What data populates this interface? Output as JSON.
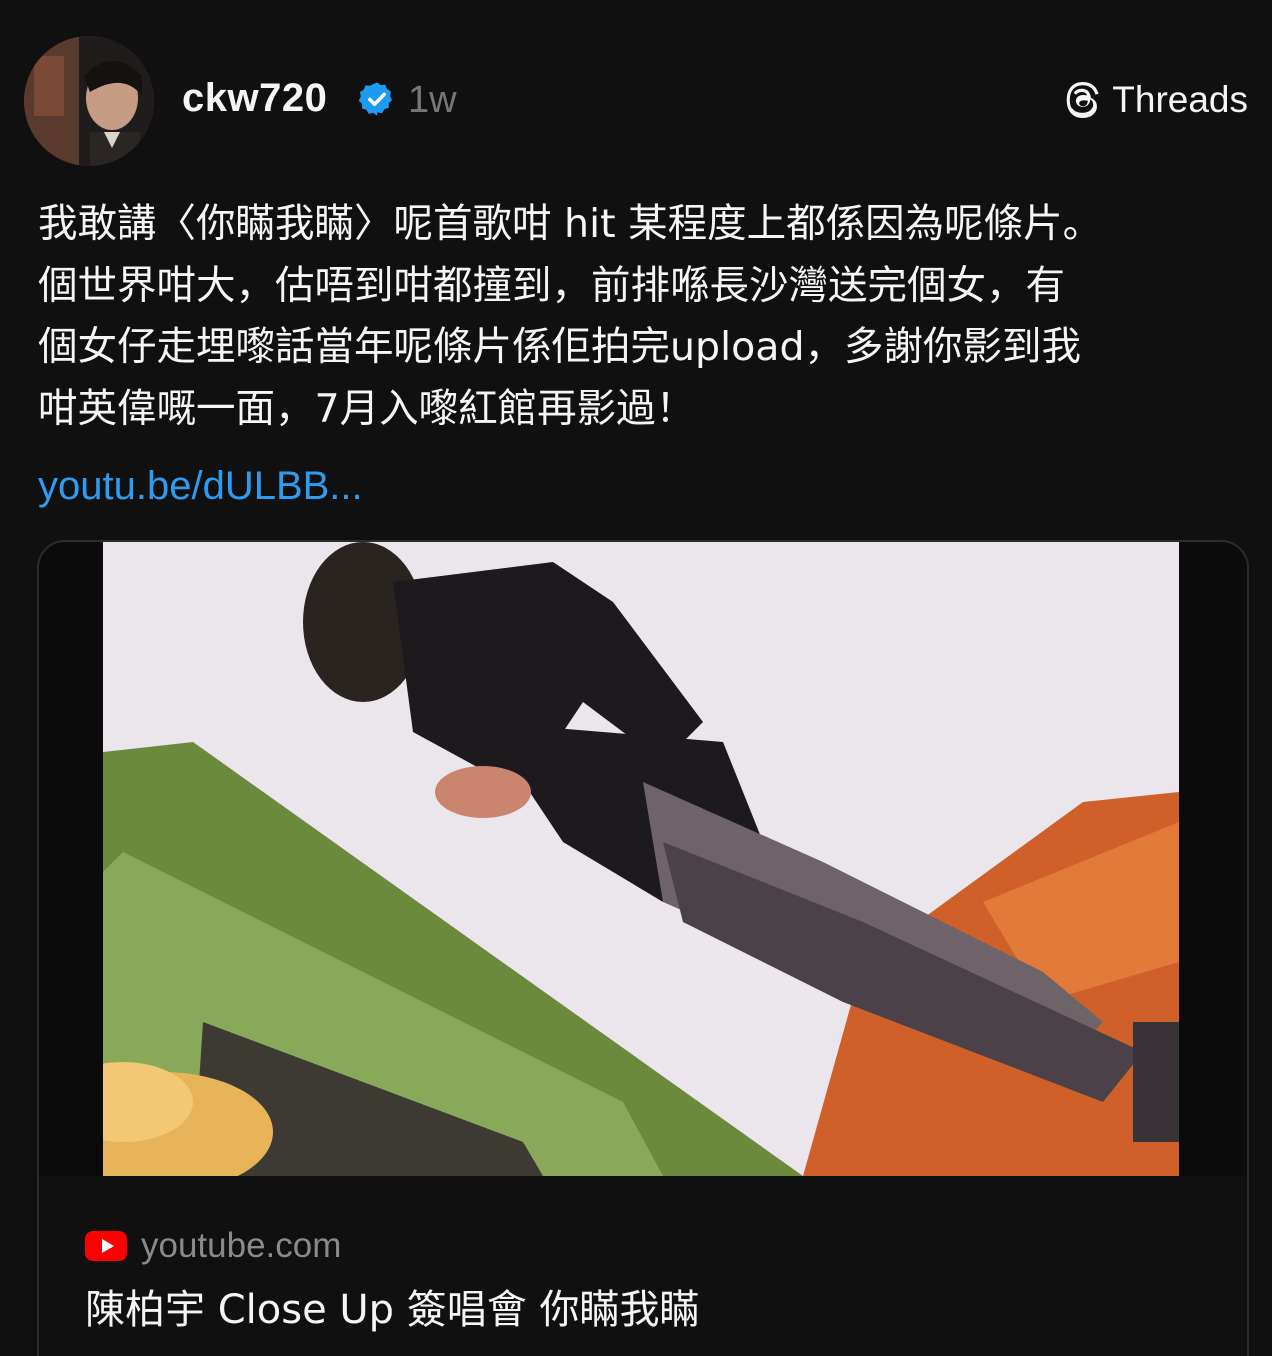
{
  "post": {
    "username": "ckw720",
    "timestamp": "1w",
    "verified": true,
    "brand_label": "Threads",
    "body_text": "我敢講〈你瞞我瞞〉呢首歌咁 hit 某程度上都係因為呢條片。\n個世界咁大，估唔到咁都撞到，前排喺長沙灣送完個女，有\n個女仔走埋嚟話當年呢條片係佢拍完upload，多謝你影到我\n咁英偉嘅一面，7月入嚟紅館再影過！",
    "link_text": "youtu.be/dULBB..."
  },
  "card": {
    "source": "youtube.com",
    "title": "陳柏宇 Close Up 簽唱會 你瞞我瞞"
  },
  "colors": {
    "background": "#101010",
    "text": "#f3f5f7",
    "muted": "#777777",
    "link": "#2d9bf0",
    "verified": "#1d9bf0",
    "youtube_red": "#ff0000"
  },
  "icons": {
    "verified": "verified-badge-icon",
    "brand": "threads-logo-icon",
    "source": "youtube-logo-icon"
  }
}
